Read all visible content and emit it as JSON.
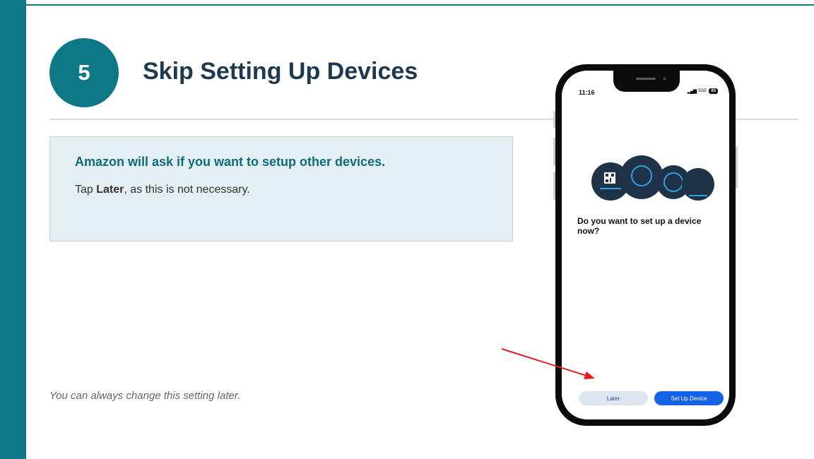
{
  "slide": {
    "step_number": "5",
    "title": "Skip Setting Up Devices",
    "info_heading": "Amazon will ask if you want to setup other devices.",
    "info_body_prefix": "Tap ",
    "info_body_bold": "Later",
    "info_body_suffix": ", as this is not necessary.",
    "note": "You can always change this setting later."
  },
  "phone": {
    "status_time": "11:16",
    "network": "5GE",
    "battery": "83",
    "prompt": "Do you want to set up a device now?",
    "later_label": "Later",
    "setup_label": "Set Up Device"
  },
  "colors": {
    "accent": "#0f7886",
    "title": "#1f3a4f",
    "info_bg": "#e3eff2",
    "setup_button": "#1463e6",
    "arrow": "#e02020"
  }
}
